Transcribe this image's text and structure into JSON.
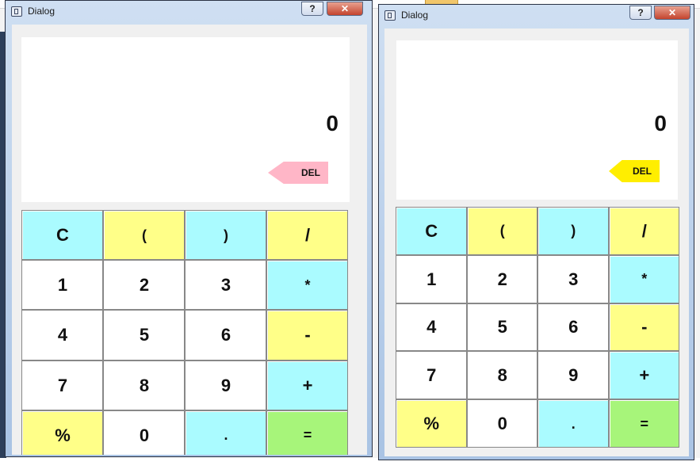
{
  "windows": [
    {
      "title": "Dialog",
      "help_label": "?",
      "close_label": "✕",
      "display_value": "0",
      "del_label": "DEL",
      "del_color": "#ffb6c7"
    },
    {
      "title": "Dialog",
      "help_label": "?",
      "close_label": "✕",
      "display_value": "0",
      "del_label": "DEL",
      "del_color": "#ffee00"
    }
  ],
  "keys": [
    {
      "label": "C",
      "color": "cyan",
      "name": "clear-button"
    },
    {
      "label": "(",
      "color": "yellow",
      "name": "open-paren-button"
    },
    {
      "label": ")",
      "color": "cyan",
      "name": "close-paren-button"
    },
    {
      "label": "/",
      "color": "yellow",
      "name": "divide-button"
    },
    {
      "label": "1",
      "color": "white",
      "name": "digit-1-button"
    },
    {
      "label": "2",
      "color": "white",
      "name": "digit-2-button"
    },
    {
      "label": "3",
      "color": "white",
      "name": "digit-3-button"
    },
    {
      "label": "*",
      "color": "cyan",
      "name": "multiply-button"
    },
    {
      "label": "4",
      "color": "white",
      "name": "digit-4-button"
    },
    {
      "label": "5",
      "color": "white",
      "name": "digit-5-button"
    },
    {
      "label": "6",
      "color": "white",
      "name": "digit-6-button"
    },
    {
      "label": "-",
      "color": "yellow",
      "name": "subtract-button"
    },
    {
      "label": "7",
      "color": "white",
      "name": "digit-7-button"
    },
    {
      "label": "8",
      "color": "white",
      "name": "digit-8-button"
    },
    {
      "label": "9",
      "color": "white",
      "name": "digit-9-button"
    },
    {
      "label": "+",
      "color": "cyan",
      "name": "add-button"
    },
    {
      "label": "%",
      "color": "yellow",
      "name": "percent-button"
    },
    {
      "label": "0",
      "color": "white",
      "name": "digit-0-button"
    },
    {
      "label": ".",
      "color": "cyan",
      "name": "decimal-button"
    },
    {
      "label": "=",
      "color": "green",
      "name": "equals-button"
    }
  ],
  "colors": {
    "cyan": "#aafbff",
    "yellow": "#ffff88",
    "white": "#ffffff",
    "green": "#a7f57a"
  }
}
